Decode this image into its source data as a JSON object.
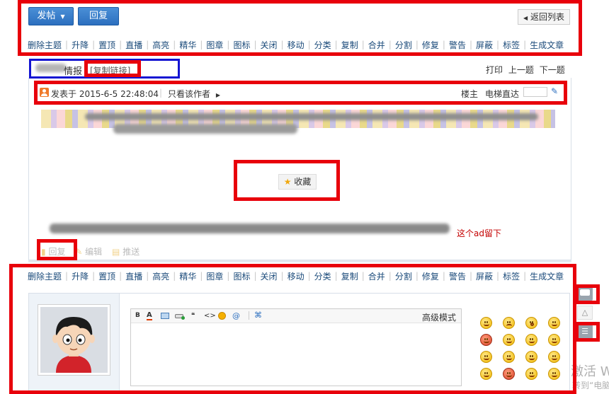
{
  "toolbar": {
    "post_button": "发帖",
    "reply_button": "回复",
    "back_link": "返回列表",
    "moderation": [
      "删除主题",
      "升降",
      "置顶",
      "直播",
      "高亮",
      "精华",
      "图章",
      "图标",
      "关闭",
      "移动",
      "分类",
      "复制",
      "合并",
      "分割",
      "修复",
      "警告",
      "屏蔽",
      "标签",
      "生成文章"
    ]
  },
  "thread": {
    "title_fragment": "情报",
    "copy_link": "[复制链接]",
    "nav": {
      "print": "打印",
      "prev": "上一题",
      "next": "下一题"
    }
  },
  "post": {
    "posted_at": "发表于 2015-6-5 22:48:04",
    "only_author": "只看该作者",
    "floor_label": "楼主",
    "jump_label": "电梯直达",
    "favorite_button": "收藏",
    "note_red": "这个ad留下",
    "actions": {
      "reply": "回复",
      "edit": "编辑",
      "push": "推送"
    }
  },
  "editor": {
    "advanced_mode": "高级模式",
    "toolbar_icons": [
      "bold-icon",
      "font-color-icon",
      "image-icon",
      "link-icon",
      "quote-icon",
      "code-icon",
      "emoji-icon",
      "at-icon",
      "attach-icon"
    ],
    "tool_glyphs": {
      "bold": "B",
      "quote": "❝",
      "code": "<>",
      "at": "@"
    }
  },
  "watermark": {
    "line1": "激活 W",
    "line2": "转到“电脑"
  },
  "colors": {
    "accent_blue": "#2c6fbf",
    "highlight_red": "#e8000b",
    "annotation_blue": "#1414d2",
    "link_text": "#1a4a7a"
  }
}
